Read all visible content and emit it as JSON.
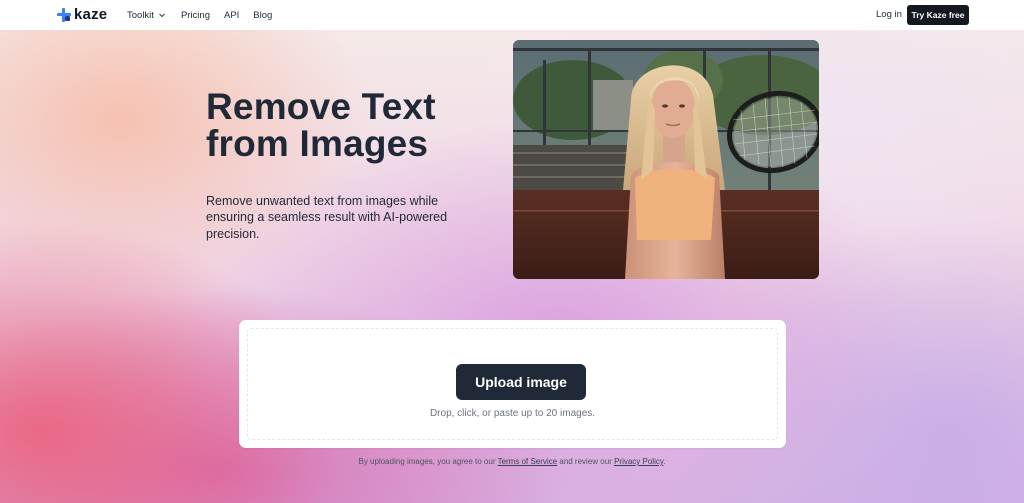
{
  "nav": {
    "logo_text": "kaze",
    "links": [
      {
        "label": "Toolkit"
      },
      {
        "label": "Pricing"
      },
      {
        "label": "API"
      },
      {
        "label": "Blog"
      }
    ],
    "login_label": "Log in",
    "cta_label": "Try Kaze free"
  },
  "hero": {
    "title_line1": "Remove Text",
    "title_line2": "from Images",
    "description": "Remove unwanted text from images while ensuring a seamless result with AI-powered precision."
  },
  "upload": {
    "button_label": "Upload image",
    "hint": "Drop, click, or paste up to 20 images."
  },
  "terms": {
    "prefix": "By uploading images, you agree to our ",
    "tos_label": "Terms of Service",
    "middle": " and review our ",
    "privacy_label": "Privacy Policy",
    "suffix": "."
  },
  "colors": {
    "primary_dark": "#1f2937",
    "cta_dark": "#14181f",
    "logo_accent": "#3b82f6"
  }
}
